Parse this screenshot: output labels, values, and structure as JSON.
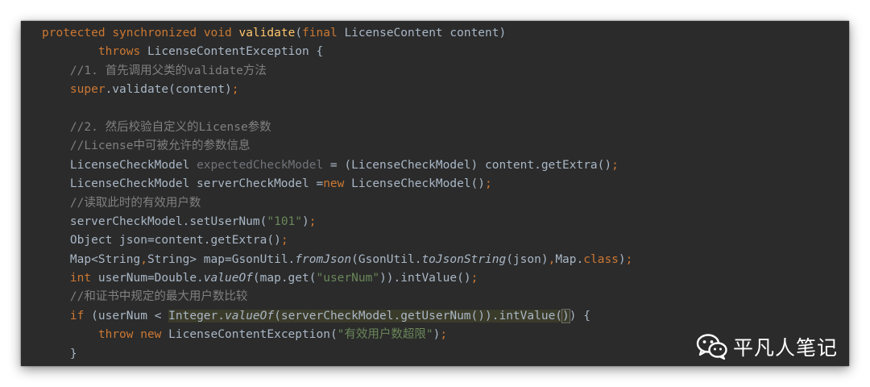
{
  "code": {
    "lines": [
      {
        "tokens": [
          {
            "t": "protected ",
            "c": "kw"
          },
          {
            "t": "synchronized ",
            "c": "kw"
          },
          {
            "t": "void ",
            "c": "kw"
          },
          {
            "t": "validate",
            "c": "fn"
          },
          {
            "t": "(",
            "c": ""
          },
          {
            "t": "final ",
            "c": "kw"
          },
          {
            "t": "LicenseContent content)",
            "c": ""
          }
        ]
      },
      {
        "tokens": [
          {
            "t": "        ",
            "c": ""
          },
          {
            "t": "throws ",
            "c": "kw"
          },
          {
            "t": "LicenseContentException {",
            "c": ""
          }
        ]
      },
      {
        "tokens": [
          {
            "t": "    ",
            "c": ""
          },
          {
            "t": "//1. 首先调用父类的validate方法",
            "c": "cm"
          }
        ]
      },
      {
        "tokens": [
          {
            "t": "    ",
            "c": ""
          },
          {
            "t": "super",
            "c": "kw"
          },
          {
            "t": ".validate(content)",
            "c": ""
          },
          {
            "t": ";",
            "c": "kw"
          }
        ]
      },
      {
        "tokens": []
      },
      {
        "tokens": [
          {
            "t": "    ",
            "c": ""
          },
          {
            "t": "//2. 然后校验自定义的License参数",
            "c": "cm"
          }
        ]
      },
      {
        "tokens": [
          {
            "t": "    ",
            "c": ""
          },
          {
            "t": "//License中可被允许的参数信息",
            "c": "cm"
          }
        ]
      },
      {
        "tokens": [
          {
            "t": "    LicenseCheckModel ",
            "c": ""
          },
          {
            "t": "expectedCheckModel",
            "c": "unused"
          },
          {
            "t": " = (LicenseCheckModel) content.getExtra()",
            "c": ""
          },
          {
            "t": ";",
            "c": "kw"
          }
        ]
      },
      {
        "tokens": [
          {
            "t": "    LicenseCheckModel serverCheckModel =",
            "c": ""
          },
          {
            "t": "new ",
            "c": "kw"
          },
          {
            "t": "LicenseCheckModel()",
            "c": ""
          },
          {
            "t": ";",
            "c": "kw"
          }
        ]
      },
      {
        "tokens": [
          {
            "t": "    ",
            "c": ""
          },
          {
            "t": "//读取此时的有效用户数",
            "c": "cm"
          }
        ]
      },
      {
        "tokens": [
          {
            "t": "    serverCheckModel.setUserNum(",
            "c": ""
          },
          {
            "t": "\"101\"",
            "c": "str"
          },
          {
            "t": ")",
            "c": ""
          },
          {
            "t": ";",
            "c": "kw"
          }
        ]
      },
      {
        "tokens": [
          {
            "t": "    Object json=content.getExtra()",
            "c": ""
          },
          {
            "t": ";",
            "c": "kw"
          }
        ]
      },
      {
        "tokens": [
          {
            "t": "    Map<String",
            "c": ""
          },
          {
            "t": ",",
            "c": "kw"
          },
          {
            "t": "String> map=GsonUtil.",
            "c": ""
          },
          {
            "t": "fromJson",
            "c": "it"
          },
          {
            "t": "(GsonUtil.",
            "c": ""
          },
          {
            "t": "toJsonString",
            "c": "it"
          },
          {
            "t": "(json)",
            "c": ""
          },
          {
            "t": ",",
            "c": "kw"
          },
          {
            "t": "Map.",
            "c": ""
          },
          {
            "t": "class",
            "c": "kw"
          },
          {
            "t": ")",
            "c": ""
          },
          {
            "t": ";",
            "c": "kw"
          }
        ]
      },
      {
        "tokens": [
          {
            "t": "    ",
            "c": ""
          },
          {
            "t": "int ",
            "c": "kw"
          },
          {
            "t": "userNum=Double.",
            "c": ""
          },
          {
            "t": "valueOf",
            "c": "it"
          },
          {
            "t": "(map.get(",
            "c": ""
          },
          {
            "t": "\"userNum\"",
            "c": "str"
          },
          {
            "t": ")).intValue()",
            "c": ""
          },
          {
            "t": ";",
            "c": "kw"
          }
        ]
      },
      {
        "tokens": [
          {
            "t": "    ",
            "c": ""
          },
          {
            "t": "//和证书中规定的最大用户数比较",
            "c": "cm"
          }
        ]
      },
      {
        "tokens": [
          {
            "t": "    ",
            "c": ""
          },
          {
            "t": "if ",
            "c": "kw"
          },
          {
            "t": "(userNum < ",
            "c": ""
          },
          {
            "t": "Integer.",
            "c": "hl"
          },
          {
            "t": "valueOf",
            "c": "hl it"
          },
          {
            "t": "(serverCheckModel.getUserNum()).intValue(",
            "c": "hl"
          },
          {
            "t": ")",
            "c": "hl matchparen"
          },
          {
            "t": ") {",
            "c": ""
          }
        ]
      },
      {
        "tokens": [
          {
            "t": "        ",
            "c": ""
          },
          {
            "t": "throw new ",
            "c": "kw"
          },
          {
            "t": "LicenseContentException(",
            "c": ""
          },
          {
            "t": "\"有效用户数超限\"",
            "c": "str"
          },
          {
            "t": ")",
            "c": ""
          },
          {
            "t": ";",
            "c": "kw"
          }
        ]
      },
      {
        "tokens": [
          {
            "t": "    }",
            "c": ""
          }
        ]
      }
    ]
  },
  "watermark": {
    "icon": "wechat-icon",
    "text": "平凡人笔记"
  }
}
